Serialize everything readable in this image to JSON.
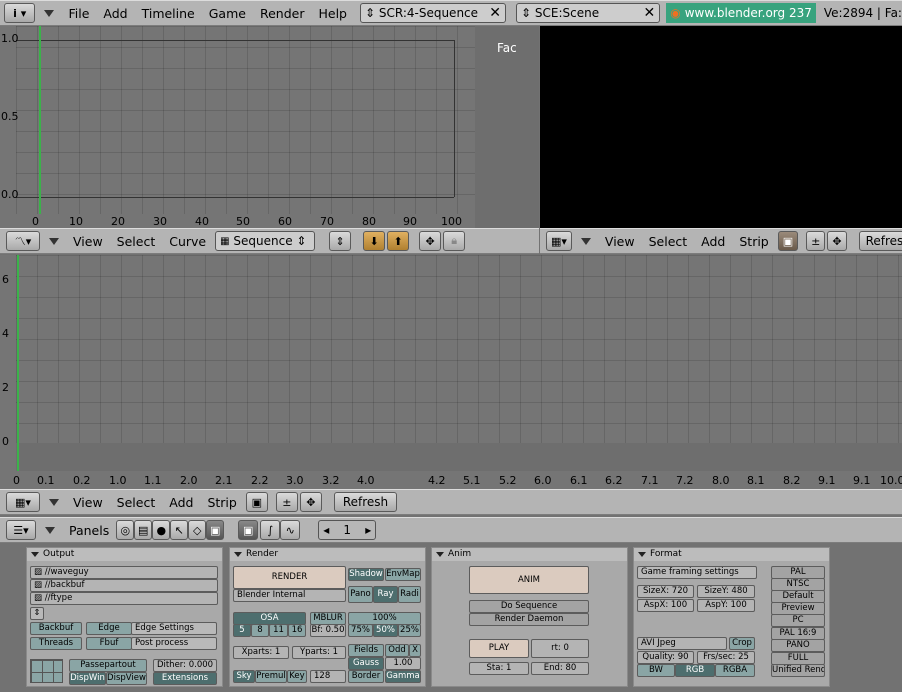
{
  "top_header": {
    "menus": [
      "File",
      "Add",
      "Timeline",
      "Game",
      "Render",
      "Help"
    ],
    "screen": "SCR:4-Sequence",
    "scene": "SCE:Scene",
    "url": "www.blender.org 237",
    "stats": "Ve:2894 | Fa:"
  },
  "ipo": {
    "y_ticks": [
      "1.0",
      "0.5",
      "0.0"
    ],
    "x_ticks": [
      "0",
      "10",
      "20",
      "30",
      "40",
      "50",
      "60",
      "70",
      "80",
      "90",
      "100"
    ],
    "channel": "Fac",
    "menus": [
      "View",
      "Select",
      "Curve"
    ],
    "type": "Sequence"
  },
  "preview": {
    "menus": [
      "View",
      "Select",
      "Add",
      "Strip"
    ],
    "refresh": "Refresh"
  },
  "seq": {
    "y_ticks": [
      "6",
      "4",
      "2",
      "0"
    ],
    "x_ticks": [
      "0",
      "0.1",
      "0.2",
      "1.0",
      "1.1",
      "2.0",
      "2.1",
      "2.2",
      "3.0",
      "3.2",
      "4.0",
      "4.2",
      "5.1",
      "5.2",
      "6.0",
      "6.1",
      "6.2",
      "7.1",
      "7.2",
      "8.0",
      "8.1",
      "8.2",
      "9.1",
      "9.1",
      "10.0"
    ],
    "menus": [
      "View",
      "Select",
      "Add",
      "Strip"
    ],
    "refresh": "Refresh"
  },
  "buttons_header": {
    "panels": "Panels",
    "frame": "1"
  },
  "output": {
    "title": "Output",
    "paths": [
      "//waveguy",
      "//backbuf",
      "//ftype"
    ],
    "backbuf": "Backbuf",
    "edge": "Edge",
    "edge_settings": "Edge Settings",
    "threads": "Threads",
    "fbuf": "Fbuf",
    "post_process": "Post process",
    "passepartout": "Passepartout",
    "dither": "Dither: 0.000",
    "dispwin": "DispWin",
    "dispview": "DispView",
    "extensions": "Extensions"
  },
  "render": {
    "title": "Render",
    "render": "RENDER",
    "shadow": "Shadow",
    "envmap": "EnvMap",
    "engine": "Blender Internal",
    "pano": "Pano",
    "ray": "Ray",
    "radi": "Radi",
    "osa": "OSA",
    "osa_vals": [
      "5",
      "8",
      "11",
      "16"
    ],
    "mblur": "MBLUR",
    "bf": "Bf: 0.50",
    "pct": "100%",
    "pct_vals": [
      "75%",
      "50%",
      "25%"
    ],
    "xparts": "Xparts: 1",
    "yparts": "Yparts: 1",
    "fields": "Fields",
    "odd": "Odd",
    "x": "X",
    "gauss": "Gauss",
    "gauss_val": "1.00",
    "sky": "Sky",
    "premul": "Premul",
    "key": "Key",
    "bits": "128",
    "border": "Border",
    "gamma": "Gamma"
  },
  "anim": {
    "title": "Anim",
    "anim": "ANIM",
    "do_sequence": "Do Sequence",
    "render_daemon": "Render Daemon",
    "play": "PLAY",
    "rt": "rt: 0",
    "sta": "Sta: 1",
    "end": "End: 80"
  },
  "format": {
    "title": "Format",
    "game_framing": "Game framing settings",
    "sizex": "SizeX: 720",
    "sizey": "SizeY: 480",
    "aspx": "AspX: 100",
    "aspy": "AspY: 100",
    "codec": "AVI Jpeg",
    "crop": "Crop",
    "quality": "Quality: 90",
    "frsec": "Frs/sec: 25",
    "bw": "BW",
    "rgb": "RGB",
    "rgba": "RGBA",
    "presets": [
      "PAL",
      "NTSC",
      "Default",
      "Preview",
      "PC",
      "PAL 16:9",
      "PANO",
      "FULL",
      "Unified Render"
    ]
  }
}
